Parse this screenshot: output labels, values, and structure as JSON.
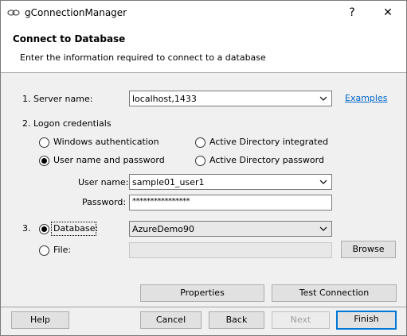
{
  "window": {
    "title": "gConnectionManager",
    "help_glyph": "?",
    "close_glyph": "✕"
  },
  "header": {
    "title": "Connect to Database",
    "subtitle": "Enter the information required to connect to a database"
  },
  "server": {
    "label": "1. Server name:",
    "value": "localhost,1433",
    "examples_link": "Examples"
  },
  "logon": {
    "label": "2. Logon credentials",
    "options": {
      "windows_auth": "Windows authentication",
      "user_pass": "User name and password",
      "ad_integrated": "Active Directory integrated",
      "ad_password": "Active Directory password"
    },
    "selected": "user_pass",
    "username_label": "User name:",
    "username_value": "sample01_user1",
    "password_label": "Password:",
    "password_value": "****************"
  },
  "database": {
    "step_label": "3.",
    "db_label": "Database:",
    "db_value": "AzureDemo90",
    "file_label": "File:",
    "browse_label": "Browse",
    "selected": "database"
  },
  "buttons": {
    "properties": "Properties",
    "test_connection": "Test Connection",
    "help": "Help",
    "cancel": "Cancel",
    "back": "Back",
    "next": "Next",
    "finish": "Finish"
  },
  "colors": {
    "accent": "#0078d7",
    "link": "#0066cc"
  }
}
